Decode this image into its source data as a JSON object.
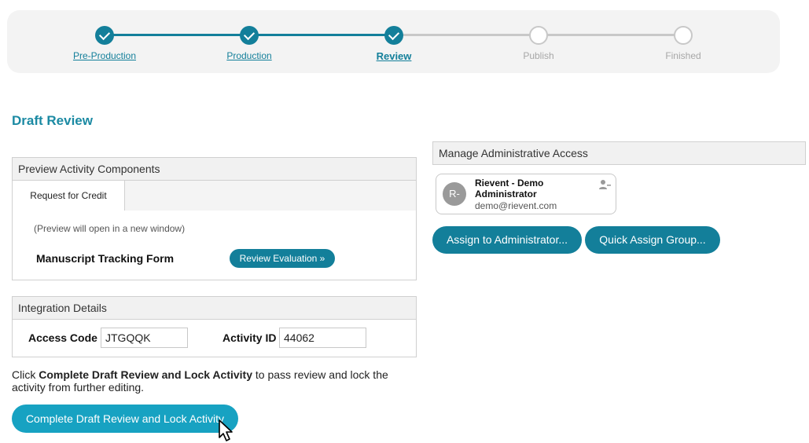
{
  "stepper": {
    "steps": [
      {
        "label": "Pre-Production",
        "state": "done"
      },
      {
        "label": "Production",
        "state": "done"
      },
      {
        "label": "Review",
        "state": "current"
      },
      {
        "label": "Publish",
        "state": "todo"
      },
      {
        "label": "Finished",
        "state": "todo"
      }
    ]
  },
  "page_title": "Draft Review",
  "preview": {
    "header": "Preview Activity Components",
    "tab_label": "Request for Credit",
    "note": "(Preview will open in a new window)",
    "form_name": "Manuscript Tracking Form",
    "evaluate_label": "Review Evaluation »"
  },
  "integration": {
    "header": "Integration Details",
    "access_code_label": "Access Code",
    "access_code_value": "JTGQQK",
    "activity_id_label": "Activity ID",
    "activity_id_value": "44062"
  },
  "instructions": {
    "prefix": "Click ",
    "emphasis": "Complete Draft Review and Lock Activity",
    "suffix": " to pass review and lock the activity from further editing."
  },
  "complete_button_label": "Complete Draft Review and Lock Activity",
  "admin": {
    "header": "Manage Administrative Access",
    "card": {
      "initials": "R-",
      "name": "Rievent - Demo Administrator",
      "email": "demo@rievent.com",
      "action_icon": "remove-user-icon"
    },
    "assign_label": "Assign to Administrator...",
    "quick_assign_label": "Quick Assign Group..."
  },
  "colors": {
    "primary": "#137f9a",
    "accent": "#17a2c2",
    "title": "#1b8aa3",
    "inactive": "#c8c8c8"
  }
}
